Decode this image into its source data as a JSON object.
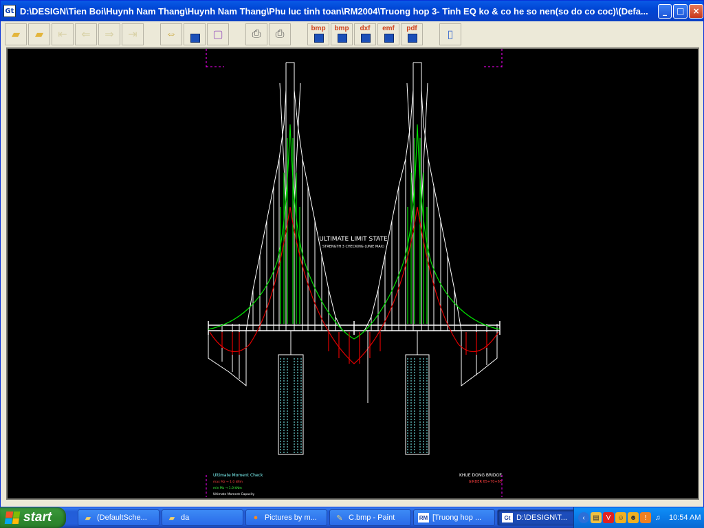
{
  "window": {
    "title": "D:\\DESIGN\\Tien Boi\\Huynh Nam Thang\\Huynh Nam Thang\\Phu luc tinh toan\\RM2004\\Truong hop 3- Tinh EQ ko & co he so nen(so do co coc)\\(Defa...",
    "app_icon_text": "Gt",
    "controls": {
      "minimize": "_",
      "maximize": "□",
      "close": "×"
    }
  },
  "toolbar": {
    "export_labels": [
      "bmp",
      "bmp",
      "dxf",
      "emf",
      "pdf"
    ]
  },
  "drawing": {
    "heading": "ULTIMATE LIMIT STATE",
    "subheading": "STRENGTH 3 CHECKING (UNIE MAX)",
    "legend_title": "Ultimate Moment Check",
    "legend_items": [
      "max Mz → 1.0 kNm",
      "min Mz → 1.0 kNm",
      "Ultimate Moment Capacity"
    ],
    "project_name": "KHUE DONG BRIDGE",
    "project_sub": "GIRDER 65+70+65",
    "colors": {
      "structure": "#ffffff",
      "capacity": "#00e000",
      "moment": "#e00000",
      "piles": "#80ffff",
      "frame": "#ff00ff"
    }
  },
  "taskbar": {
    "start_label": "start",
    "tasks": [
      {
        "label": "(DefaultSche...",
        "icon": "folder-icon"
      },
      {
        "label": "da",
        "icon": "folder-icon"
      },
      {
        "label": "Pictures by m...",
        "icon": "firefox-icon"
      },
      {
        "label": "C.bmp - Paint",
        "icon": "paint-icon"
      },
      {
        "label": "[Truong hop ...",
        "icon": "rm-app-icon"
      },
      {
        "label": "D:\\DESIGN\\T...",
        "icon": "gt-app-icon"
      }
    ],
    "clock": "10:54 AM"
  }
}
